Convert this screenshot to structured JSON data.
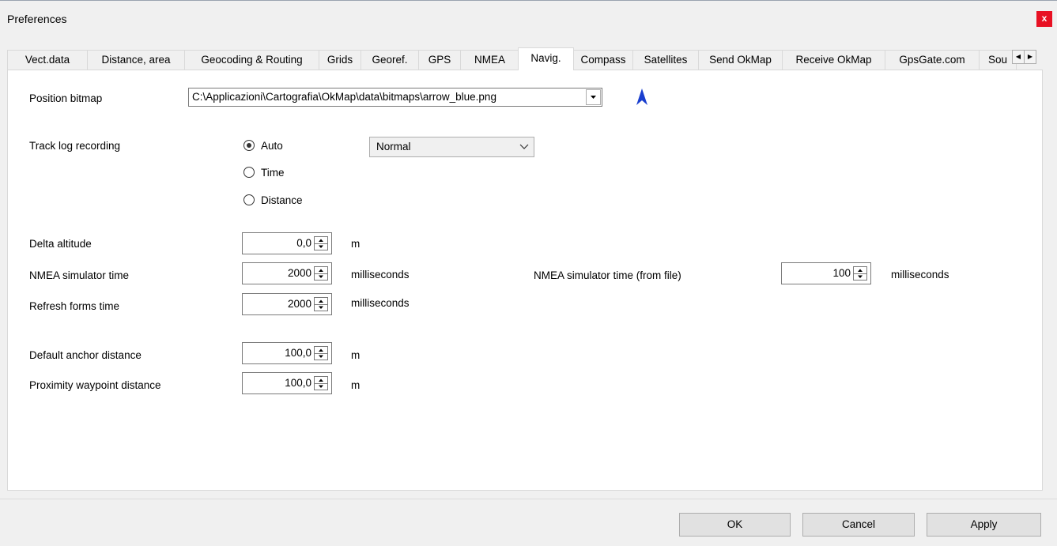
{
  "window": {
    "title": "Preferences",
    "close_label": "x"
  },
  "tabs": [
    "Vect.data",
    "Distance, area",
    "Geocoding & Routing",
    "Grids",
    "Georef.",
    "GPS",
    "NMEA",
    "Navig.",
    "Compass",
    "Satellites",
    "Send OkMap",
    "Receive OkMap",
    "GpsGate.com",
    "Sou"
  ],
  "active_tab": "Navig.",
  "position_bitmap": {
    "label": "Position bitmap",
    "value": "C:\\Applicazioni\\Cartografia\\OkMap\\data\\bitmaps\\arrow_blue.png"
  },
  "track_log": {
    "label": "Track log recording",
    "options": [
      "Auto",
      "Time",
      "Distance"
    ],
    "selected": "Auto",
    "mode_value": "Normal"
  },
  "fields": {
    "delta_altitude": {
      "label": "Delta altitude",
      "value": "0,0",
      "unit": "m"
    },
    "nmea_sim_time": {
      "label": "NMEA simulator time",
      "value": "2000",
      "unit": "milliseconds"
    },
    "nmea_sim_time_file": {
      "label": "NMEA simulator time (from file)",
      "value": "100",
      "unit": "milliseconds"
    },
    "refresh_forms_time": {
      "label": "Refresh forms time",
      "value": "2000",
      "unit": "milliseconds"
    },
    "default_anchor": {
      "label": "Default anchor distance",
      "value": "100,0",
      "unit": "m"
    },
    "proximity_waypoint": {
      "label": "Proximity waypoint distance",
      "value": "100,0",
      "unit": "m"
    }
  },
  "buttons": {
    "ok": "OK",
    "cancel": "Cancel",
    "apply": "Apply"
  },
  "colors": {
    "close": "#e81123",
    "arrow": "#1a3fcf"
  }
}
